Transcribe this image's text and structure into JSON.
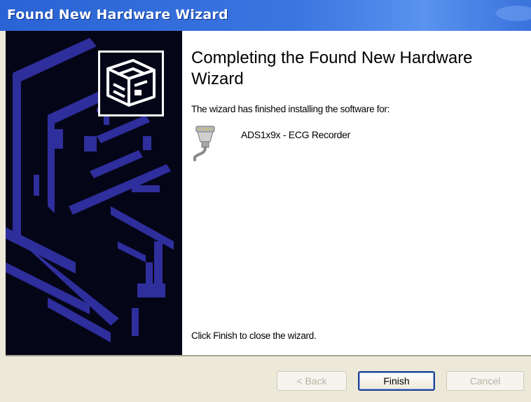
{
  "window": {
    "title": "Found New Hardware Wizard"
  },
  "content": {
    "heading": "Completing the Found New Hardware Wizard",
    "subtext": "The wizard has finished installing the software for:",
    "device": {
      "icon": "serial-port-icon",
      "name": "ADS1x9x - ECG Recorder"
    },
    "close_instruction": "Click Finish to close the wizard."
  },
  "buttons": {
    "back_label": "< Back",
    "finish_label": "Finish",
    "cancel_label": "Cancel"
  },
  "colors": {
    "titlebar": "#2a63d4",
    "left_panel_bg": "#050518",
    "left_panel_graphic": "#2e2e9c",
    "button_bar": "#ece9d8"
  },
  "icons": {
    "banner": "hardware-install-icon"
  }
}
